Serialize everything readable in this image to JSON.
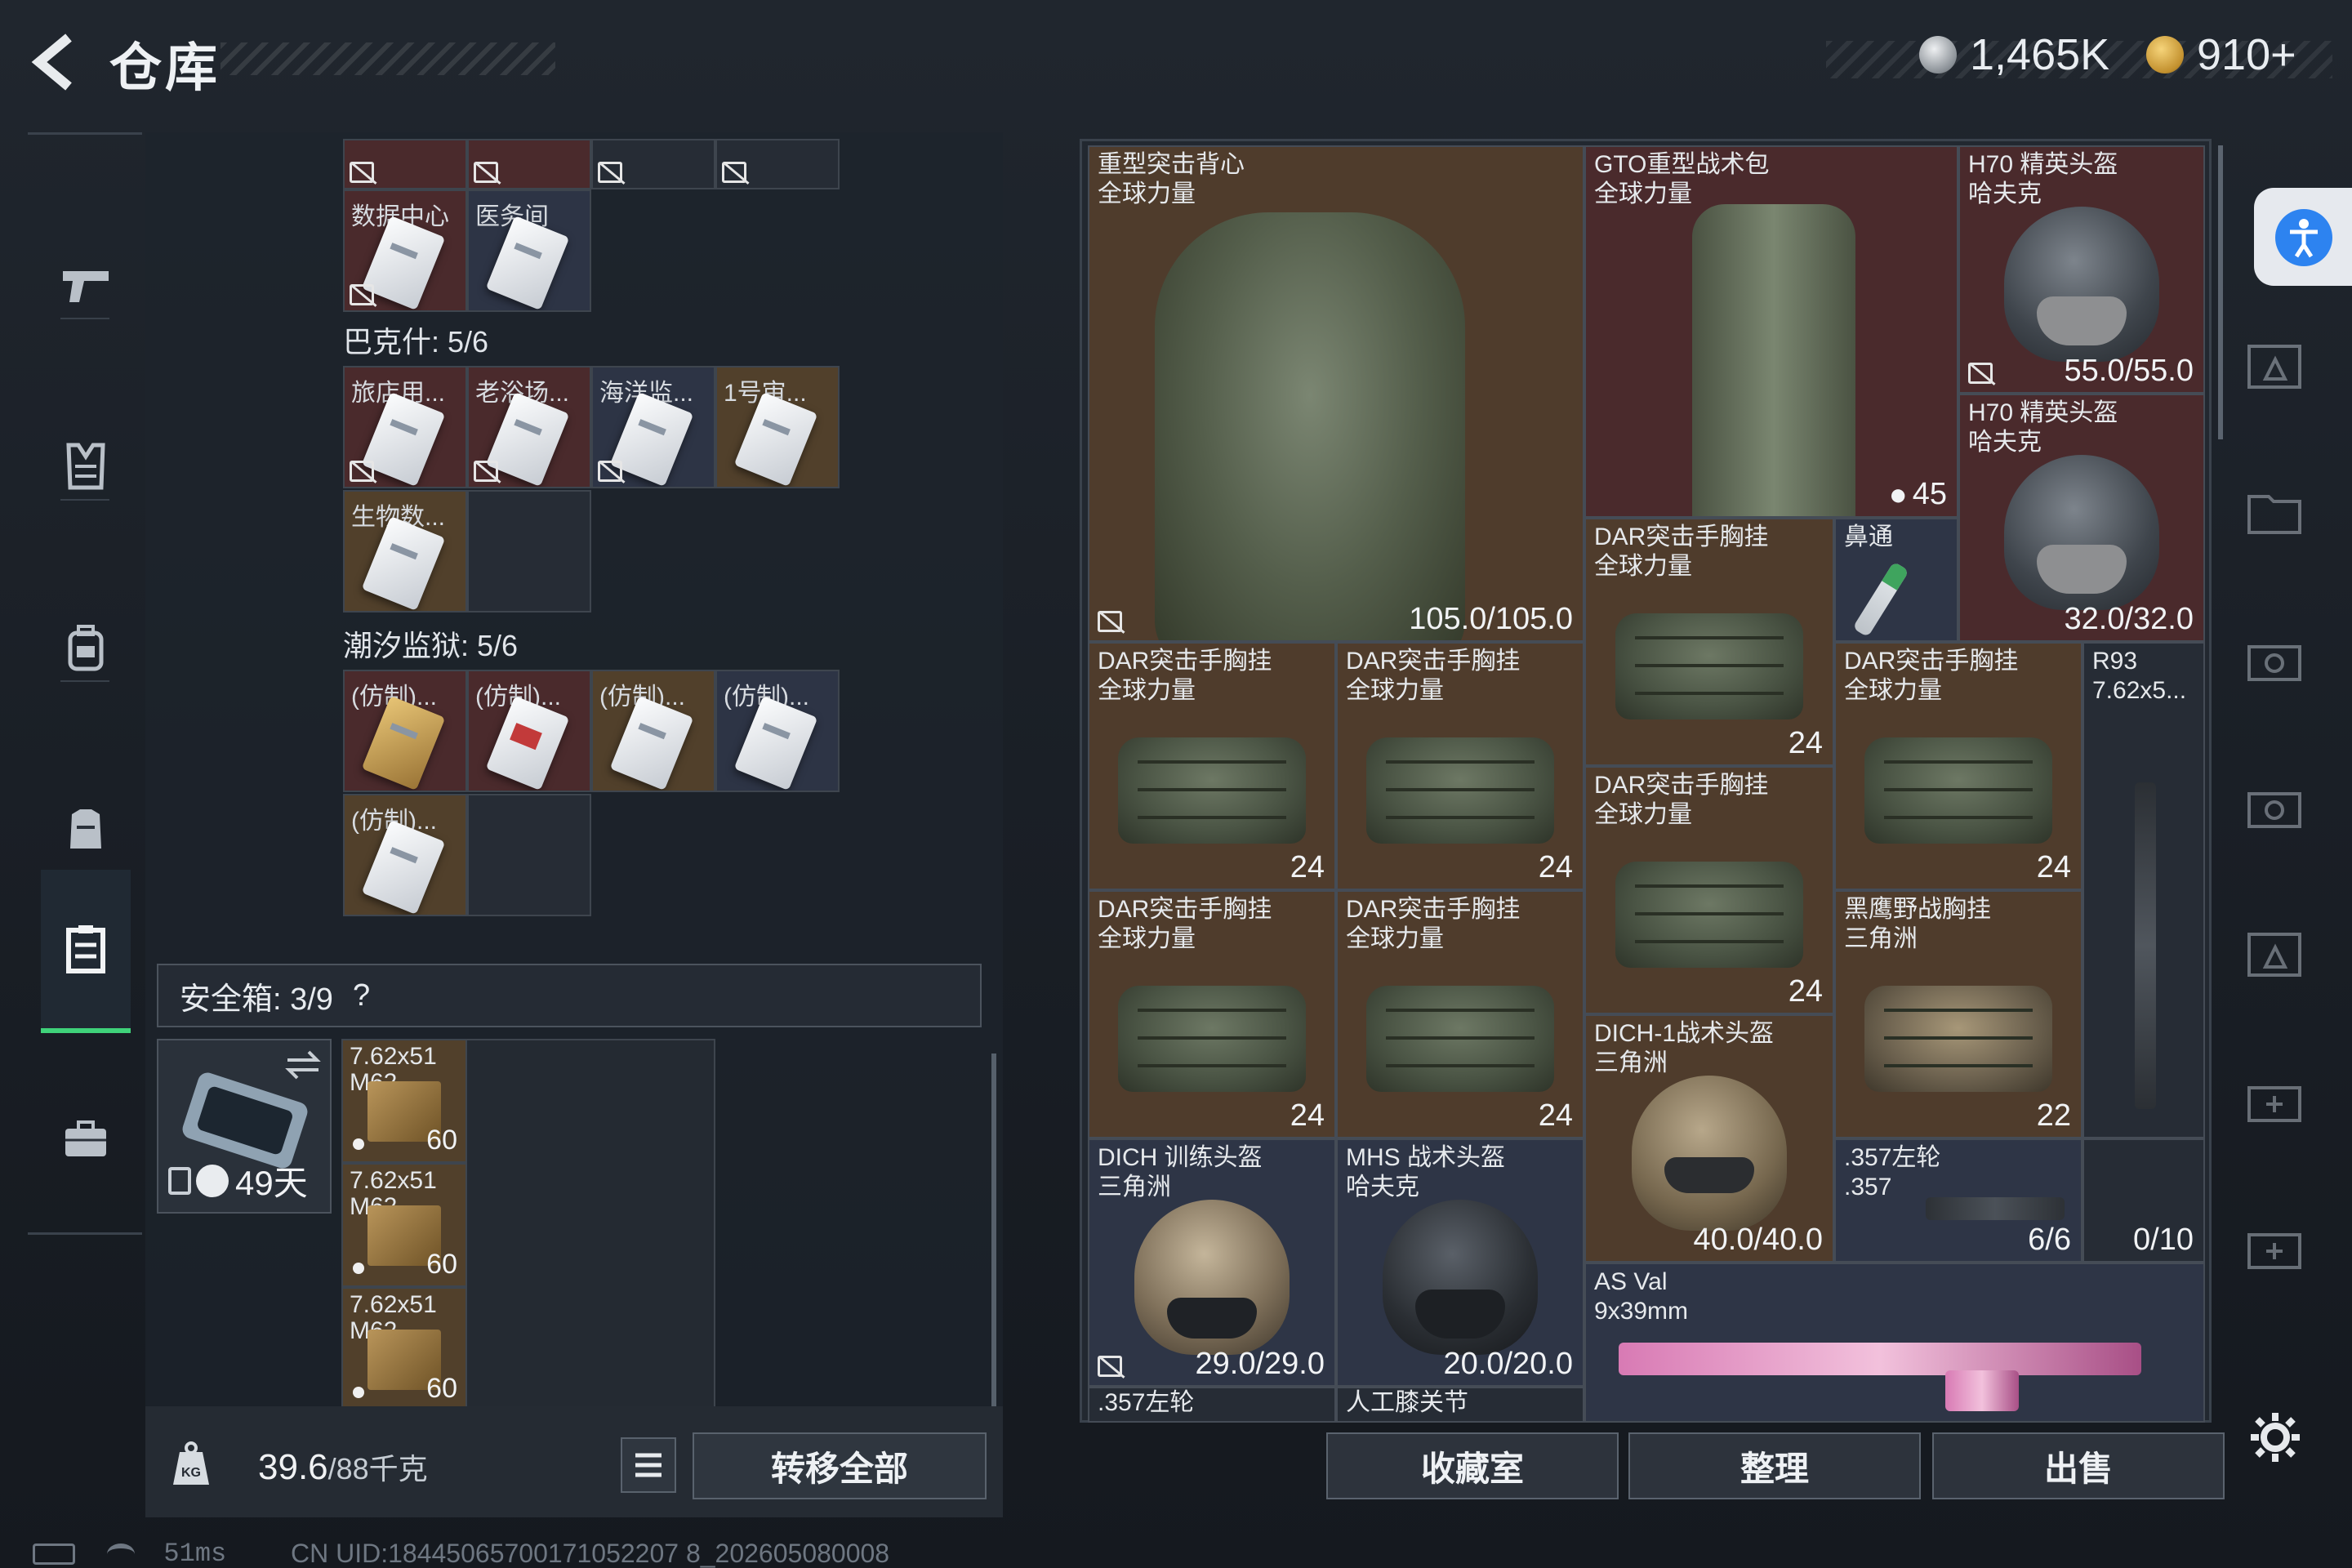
{
  "header": {
    "title": "仓库",
    "currency_silver": "1,465K",
    "currency_gold": "910+"
  },
  "nav": {
    "items": [
      "pistol-icon",
      "armor-icon",
      "backpack-icon",
      "rig-icon",
      "stash-icon",
      "briefcase-icon"
    ],
    "active": "stash-icon"
  },
  "stash": {
    "top_row_labels": [
      "数据中心",
      "医务间"
    ],
    "section1": "巴克什: 5/6",
    "section1_cards": [
      "旅店用...",
      "老浴场...",
      "海洋监...",
      "1号审...",
      "生物数..."
    ],
    "section2": "潮汐监狱: 5/6",
    "section2_cards": [
      "(仿制)...",
      "(仿制)...",
      "(仿制)...",
      "(仿制)...",
      "(仿制)..."
    ]
  },
  "safebox": {
    "label": "安全箱: 3/9",
    "help": "?",
    "days": "49天",
    "ammo": [
      {
        "line1": "7.62x51",
        "line2": "M62",
        "count": "60"
      },
      {
        "line1": "7.62x51",
        "line2": "M62",
        "count": "60"
      },
      {
        "line1": "7.62x51",
        "line2": "M62",
        "count": "60"
      }
    ]
  },
  "footer_left": {
    "weight": "39.6",
    "capacity": "/88千克",
    "transfer_all": "转移全部"
  },
  "items": {
    "vest": {
      "name": "重型突击背心\n全球力量",
      "value": "105.0/105.0"
    },
    "pack": {
      "name": "GTO重型战术包\n全球力量",
      "count": "45"
    },
    "h70a": {
      "name": "H70 精英头盔\n哈夫克",
      "value": "55.0/55.0"
    },
    "h70b": {
      "name": "H70 精英头盔\n哈夫克",
      "value": "32.0/32.0"
    },
    "dar_mid_top": {
      "name": "DAR突击手胸挂\n全球力量",
      "count": "24"
    },
    "nose": {
      "name": "鼻通"
    },
    "dar1": {
      "name": "DAR突击手胸挂\n全球力量",
      "count": "24"
    },
    "dar2": {
      "name": "DAR突击手胸挂\n全球力量",
      "count": "24"
    },
    "dar3": {
      "name": "DAR突击手胸挂\n全球力量",
      "count": "24"
    },
    "dar4": {
      "name": "DAR突击手胸挂\n全球力量",
      "count": "24"
    },
    "dar5": {
      "name": "DAR突击手胸挂\n全球力量",
      "count": "24"
    },
    "dar6": {
      "name": "DAR突击手胸挂\n全球力量",
      "count": "24"
    },
    "r93": {
      "name": "R93\n7.62x5...",
      "count": "0/10"
    },
    "blackhawk": {
      "name": "黑鹰野战胸挂\n三角洲",
      "count": "22"
    },
    "dich1": {
      "name": "DICH-1战术头盔\n三角洲",
      "value": "40.0/40.0"
    },
    "revolver": {
      "name": ".357左轮\n.357",
      "count": "6/6"
    },
    "dich_train": {
      "name": "DICH 训练头盔\n三角洲",
      "value": "29.0/29.0"
    },
    "mhs": {
      "name": "MHS 战术头盔\n哈夫克",
      "value": "20.0/20.0"
    },
    "asval": {
      "name": "AS Val\n9x39mm"
    },
    "partial1": {
      "name": ".357左轮"
    },
    "partial2": {
      "name": "人工膝关节"
    }
  },
  "footer_right": {
    "collection": "收藏室",
    "sort": "整理",
    "sell": "出售"
  },
  "status": {
    "ping": "51ms",
    "uid": "CN UID:18445065700171052207 8_202605080008"
  }
}
